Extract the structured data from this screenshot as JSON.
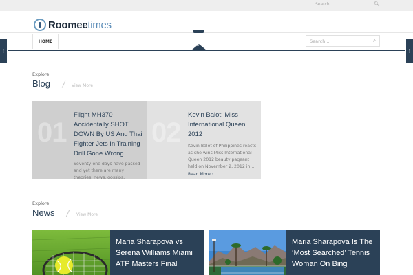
{
  "topbar": {
    "search_placeholder": "Search ..."
  },
  "logo": {
    "part1": "Roomee",
    "part2": "times"
  },
  "nav": {
    "home_label": "HOME",
    "search_placeholder": "Search ..."
  },
  "blog": {
    "explore": "Explore",
    "title": "Blog",
    "view_more": "View More",
    "cards": [
      {
        "number": "01",
        "title": "Flight MH370 Accidentally SHOT DOWN By US And Thai Fighter Jets In Training Drill Gone Wrong",
        "excerpt": "Seventy-one days have passed and yet there are many theories, news, gossips, suggestions and"
      },
      {
        "number": "02",
        "title": "Kevin Balot: Miss International Queen 2012",
        "excerpt": "Kevin Balot of Philippines reacts as she wins Miss International Queen 2012 beauty pageant held on November 2, 2012 in...",
        "read_more": "Read More ›"
      }
    ]
  },
  "news": {
    "explore": "Explore",
    "title": "News",
    "view_more": "View More",
    "cards": [
      {
        "title": "Maria Sharapova vs Serena Williams Miami ATP Masters Final"
      },
      {
        "title": "Maria Sharapova Is The ‘Most Searched’ Tennis Woman On Bing"
      }
    ]
  },
  "colors": {
    "navy": "#2b4157",
    "accent_blue": "#5c8db8"
  },
  "icons": {
    "search": "search-icon",
    "nav_toggle": "chevron-up-icon"
  }
}
